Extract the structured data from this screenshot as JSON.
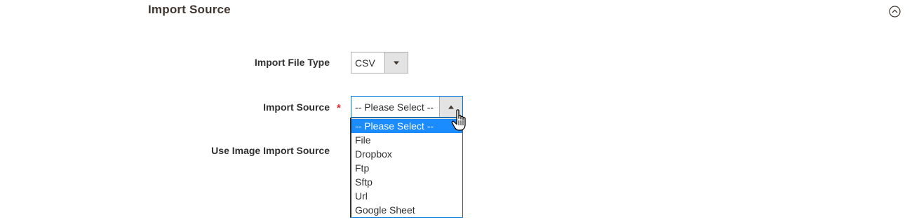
{
  "section": {
    "title": "Import Source",
    "collapse_icon": "chevron-up-circle-icon"
  },
  "fields": {
    "import_file_type": {
      "label": "Import File Type",
      "value": "CSV",
      "arrow_icon": "caret-down-icon"
    },
    "import_source": {
      "label": "Import Source",
      "required_mark": "*",
      "value": "-- Please Select --",
      "arrow_icon": "caret-up-icon",
      "options": [
        "-- Please Select --",
        "File",
        "Dropbox",
        "Ftp",
        "Sftp",
        "Url",
        "Google Sheet"
      ],
      "selected_index": 0
    },
    "use_image_import_source": {
      "label": "Use Image Import Source"
    }
  },
  "colors": {
    "required": "#e22626",
    "highlight": "#1a8cff",
    "focus_border": "#007bdb"
  },
  "cursor": "hand-pointer-icon"
}
